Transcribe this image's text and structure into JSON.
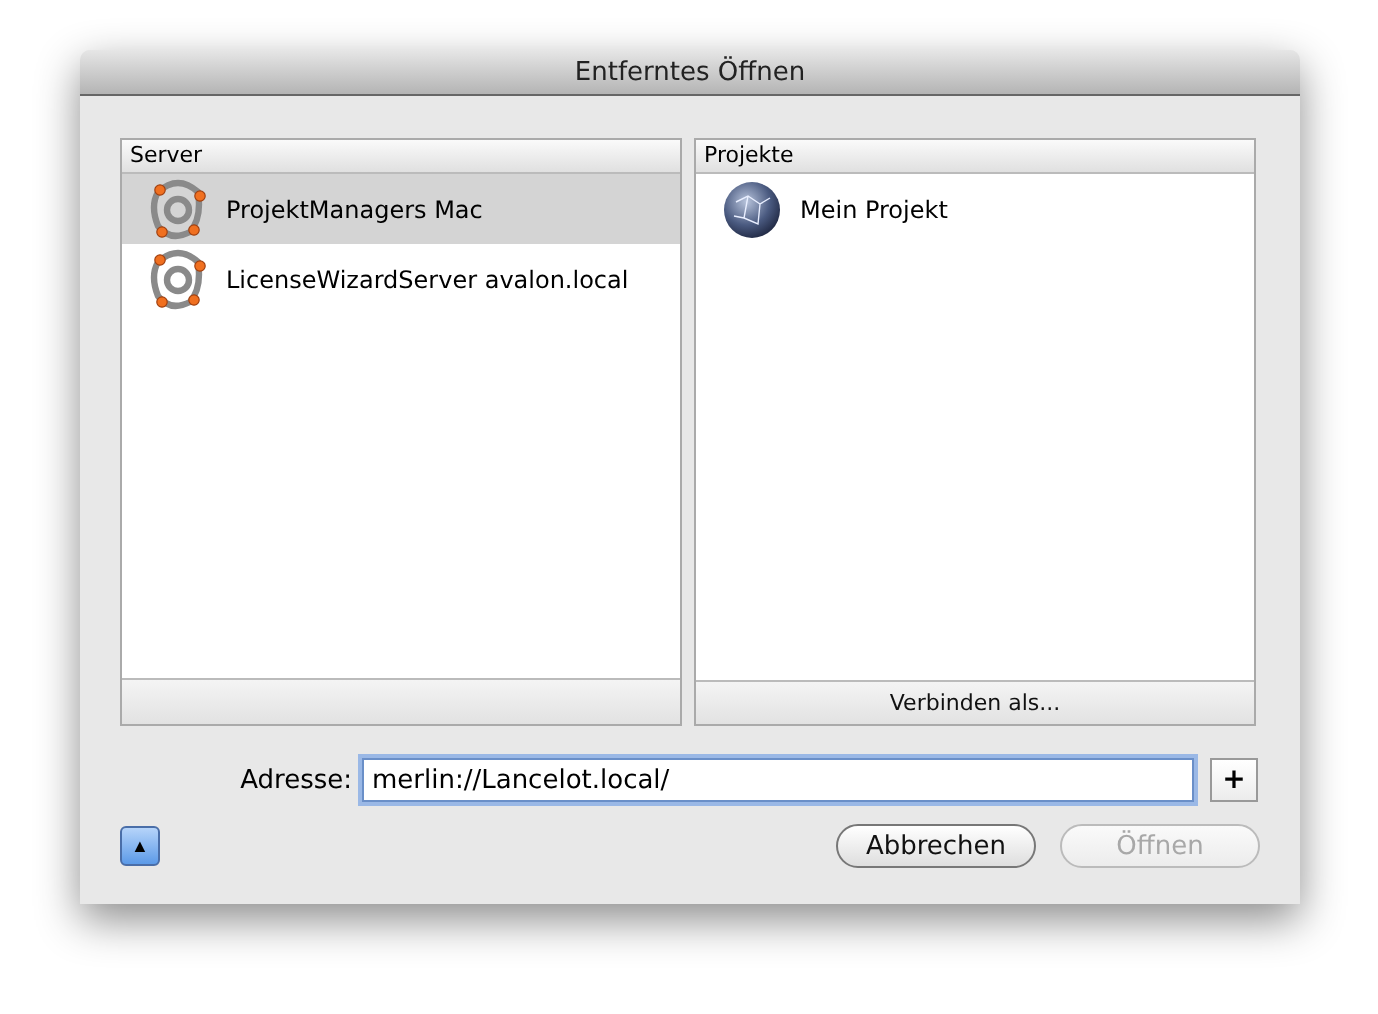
{
  "window": {
    "title": "Entferntes Öffnen"
  },
  "server_list": {
    "header": "Server",
    "items": [
      {
        "label": "ProjektManagers Mac",
        "selected": true
      },
      {
        "label": "LicenseWizardServer avalon.local",
        "selected": false
      }
    ]
  },
  "project_list": {
    "header": "Projekte",
    "items": [
      {
        "label": "Mein Projekt",
        "selected": false
      }
    ],
    "footer_button": "Verbinden als..."
  },
  "address": {
    "label": "Adresse:",
    "value": "merlin://Lancelot.local/",
    "add_button": "+"
  },
  "disclosure_button": "▲",
  "buttons": [
    {
      "label": "Abbrechen",
      "disabled": false
    },
    {
      "label": "Öffnen",
      "disabled": true
    }
  ]
}
